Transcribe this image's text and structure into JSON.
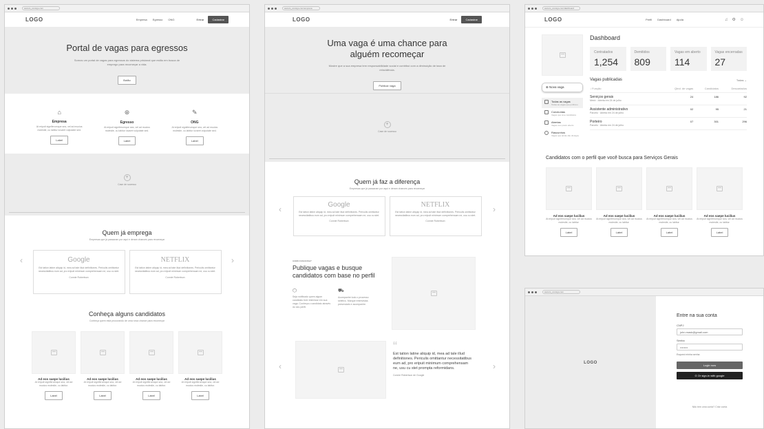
{
  "window1": {
    "url": "www.ts_consigo.com",
    "nav": {
      "logo": "LOGO",
      "links": [
        "Empresa",
        "Egresso",
        "ONG"
      ],
      "enter": "Entrar",
      "register": "Cadastrar"
    },
    "hero": {
      "title": "Portal de vagas para egressos",
      "subtitle": "Somos um portal de vagas para egressos do sistema prisional que estão em busca de emprego para recomeçar a vida.",
      "button": "Botão"
    },
    "features": [
      {
        "title": "Empresa",
        "text": "At eripuit signiferumque sea, vel ad mucius molestie, cu labitur iuvaret vulputate sed.",
        "button": "Label"
      },
      {
        "title": "Egresso",
        "text": "At eripuit signiferumque sea, vel ad mucius molestie, cu labitur iuvaret vulputate sed.",
        "button": "Label"
      },
      {
        "title": "ONG",
        "text": "At eripuit signiferumque sea, vel ad mucius molestie, cu labitur iuvaret vulputate sed.",
        "button": "Label"
      }
    ],
    "case": "Case de sucesso",
    "employers": {
      "title": "Quem já emprega",
      "subtitle": "Empresas que já passaram por aqui e deram chances para recomeçar"
    },
    "testimonials": [
      {
        "brand": "Google",
        "text": "Est tation latine aliquip id, mea ad tale illud definitiones. Periculis omittantur necessitatibus eum ad, pro eripuit minimum comprehensam ne, usu cu stet.",
        "author": "Connie Robertson"
      },
      {
        "brand": "NETFLIX",
        "text": "Est tation latine aliquip id, mea ad tale illud definitiones. Periculis omittantur necessitatibus eum ad, pro eripuit minimum comprehensam ne, usu cu stet.",
        "author": "Connie Robertson"
      }
    ],
    "candidates": {
      "title": "Conheça alguns candidatos",
      "subtitle": "Conheça quem está procurando de uma nova chance para recomeçar"
    },
    "candidate_cards": [
      {
        "name": "Ad eos saepe lucilius",
        "text": "At eripuit signiferumque sea, vel ad mucius molestie, cu labitur.",
        "button": "Label"
      },
      {
        "name": "Ad eos saepe lucilius",
        "text": "At eripuit signiferumque sea, vel ad mucius molestie, cu labitur.",
        "button": "Label"
      },
      {
        "name": "Ad eos saepe lucilius",
        "text": "At eripuit signiferumque sea, vel ad mucius molestie, cu labitur.",
        "button": "Label"
      },
      {
        "name": "Ad eos saepe lucilius",
        "text": "At eripuit signiferumque sea, vel ad mucius molestie, cu labitur.",
        "button": "Label"
      }
    ]
  },
  "window2": {
    "url": "www.ts_consigo.com/empresa",
    "nav": {
      "logo": "LOGO",
      "enter": "Entrar",
      "register": "Cadastrar"
    },
    "hero": {
      "title": "Uma vaga é uma chance para alguém recomeçar",
      "subtitle": "Mostre que a sua empresa tem responsabilidade social e contribui com a diminuição de taxa de reincidência.",
      "button": "Publicar vaga"
    },
    "case": "Case de sucesso",
    "diff": {
      "title": "Quem já faz a diferença",
      "subtitle": "Empresas que já passaram por aqui e deram chances para recomeçar"
    },
    "testimonials": [
      {
        "brand": "Google",
        "text": "Est tation latine aliquip id, mea ad tale illud definitiones. Periculis omittantur necessitatibus eum ad, pro eripuit minimum comprehensam ne, usu cu stet.",
        "author": "Connie Robertson"
      },
      {
        "brand": "NETFLIX",
        "text": "Est tation latine aliquip id, mea ad tale illud definitiones. Periculis omittantur necessitatibus eum ad, pro eripuit minimum comprehensam ne, usu cu stet.",
        "author": "Connie Robertson"
      }
    ],
    "how": {
      "eyebrow": "COMO FUNCIONA?",
      "title": "Publique vagas e busque candidatos com base no perfil"
    },
    "how_items": [
      {
        "text": "Seja notificado quem algum candidato tiver interesse em sua vaga. Conheça o candidato através do seu perfil."
      },
      {
        "text": "Acompanhe todo o processo seletivo. Marque entrevistas presenciais e acompanhe."
      }
    ],
    "quote": {
      "text": "Est tation latine aliquip id, mea ad tale illud definitiones. Periculis omittantur necessitatibus eum ad, pro eripuit minimum comprehensam ne, usu cu stet prompta reformidans.",
      "author": "Connie Robertson de Google"
    }
  },
  "window3": {
    "url": "www.ts_consigo.com/dashboard",
    "nav": {
      "logo": "LOGO",
      "links": [
        "Perfil",
        "Dashboard",
        "Ajuda"
      ]
    },
    "title": "Dashboard",
    "stats": [
      {
        "label": "Contratados",
        "value": "1,254"
      },
      {
        "label": "Demitidos",
        "value": "809"
      },
      {
        "label": "Vagas em aberto",
        "value": "114"
      },
      {
        "label": "Vagas encerradas",
        "value": "27"
      }
    ],
    "new_button": "Nova vaga",
    "sidebar": [
      {
        "label": "Todas as vagas",
        "sub": "Todas as vagas que publicou"
      },
      {
        "label": "Concluídas",
        "sub": "Vagas que teve candidatos"
      },
      {
        "label": "Abertas",
        "sub": "Vagas com prazo aberto"
      },
      {
        "label": "Rascunhos",
        "sub": "Vagas que ainda não divulgou"
      }
    ],
    "jobs_title": "Vagas publicadas",
    "filter": "Todas",
    "table_headers": [
      "↓ Função",
      "Qtnd. de vagas",
      "Candidatos",
      "Descartados"
    ],
    "table_rows": [
      {
        "role": "Serviços gerais",
        "sub": "Mesh · Aberta em 24 de julho",
        "qty": "24",
        "cand": "186",
        "disc": "92"
      },
      {
        "role": "Assistente administrativo",
        "sub": "Parcelo · Aberta em 24 de julho",
        "qty": "02",
        "cand": "95",
        "disc": "21"
      },
      {
        "role": "Porteiro",
        "sub": "Parcelo · Aberta em 24 de julho",
        "qty": "07",
        "cand": "301",
        "disc": "296"
      }
    ],
    "candidates_title": "Candidatos com o perfil que você busca para Serviços Gerais",
    "cards": [
      {
        "name": "Ad eos saepe lucilius",
        "text": "At eripuit signiferumque sea, vel ad mucius molestie, cu labitur.",
        "button": "Label"
      },
      {
        "name": "Ad eos saepe lucilius",
        "text": "At eripuit signiferumque sea, vel ad mucius molestie, cu labitur.",
        "button": "Label"
      },
      {
        "name": "Ad eos saepe lucilius",
        "text": "At eripuit signiferumque sea, vel ad mucius molestie, cu labitur.",
        "button": "Label"
      },
      {
        "name": "Ad eos saepe lucilius",
        "text": "At eripuit signiferumque sea, vel ad mucius molestie, cu labitur.",
        "button": "Label"
      }
    ]
  },
  "window4": {
    "url": "www.ts_consigo.com",
    "logo": "LOGO",
    "title": "Entre na sua conta",
    "cnpj_label": "CNPJ",
    "cnpj_value": "john.mask@gmail.com",
    "pass_label": "Senha",
    "pass_value": "••••••••",
    "forgot": "Esqueci minha senha",
    "login": "Login now",
    "google": "Or sign-in with google",
    "footer": "Não tem uma conta? Criar conta"
  }
}
